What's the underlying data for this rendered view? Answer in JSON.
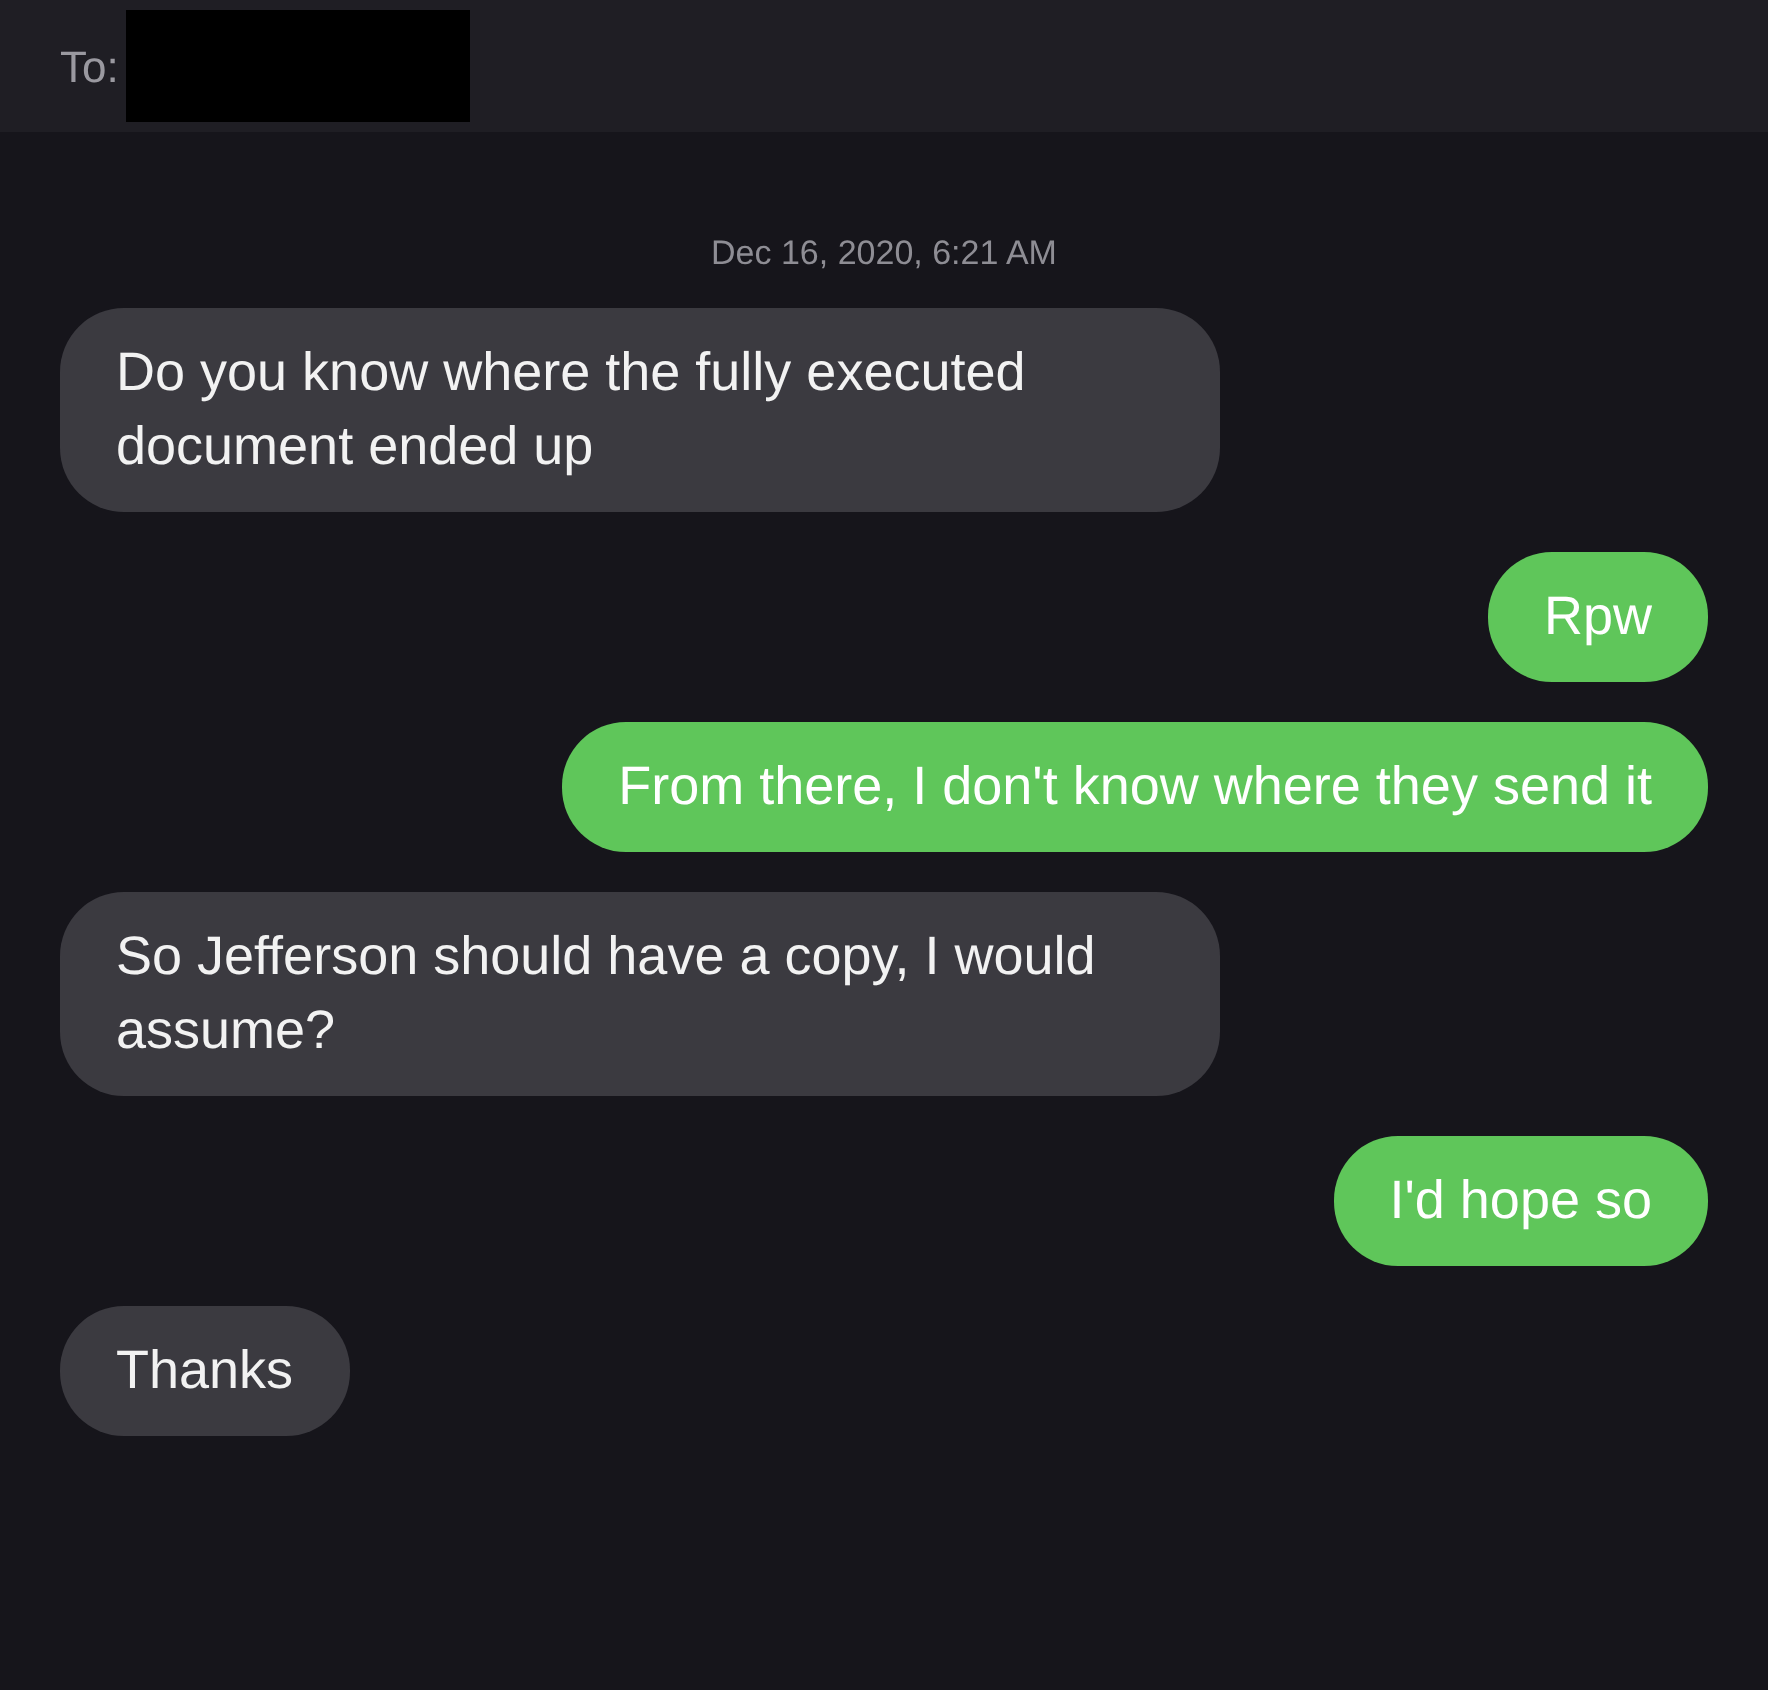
{
  "header": {
    "label": "To:",
    "recipient_redacted": true
  },
  "timestamp": "Dec 16, 2020, 6:21 AM",
  "messages": [
    {
      "kind": "received",
      "text": "Do you know where the fully executed document ended up"
    },
    {
      "kind": "sent",
      "text": "Rpw"
    },
    {
      "kind": "sent",
      "text": "From there, I don't know where they send it"
    },
    {
      "kind": "received",
      "text": "So Jefferson should have a copy, I would assume?"
    },
    {
      "kind": "sent",
      "text": "I'd hope so"
    },
    {
      "kind": "received",
      "text": "Thanks"
    }
  ]
}
